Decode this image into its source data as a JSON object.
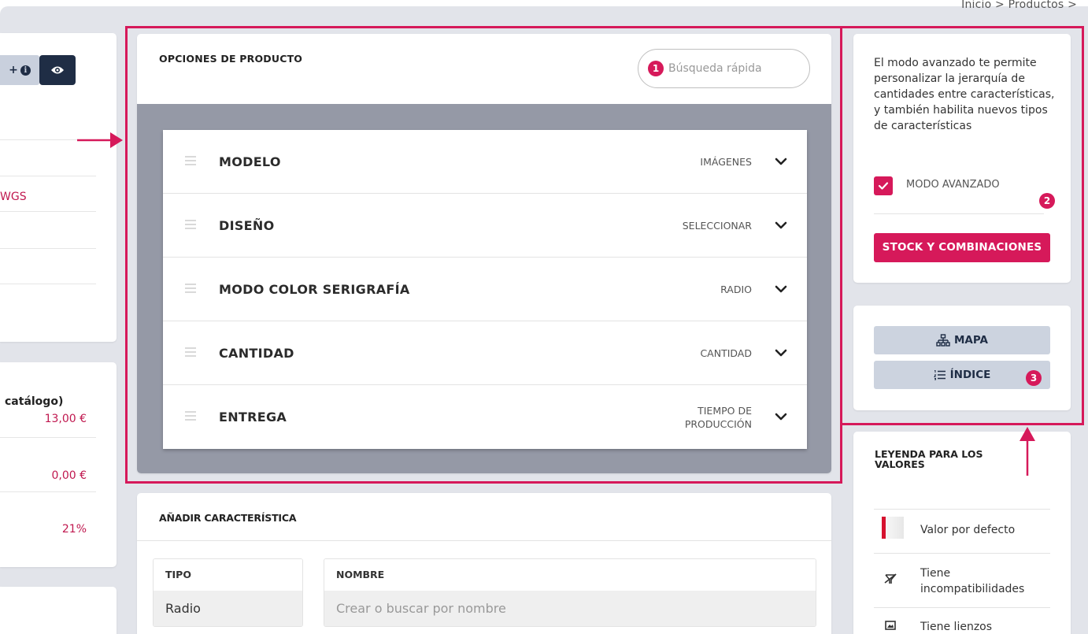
{
  "breadcrumb": "Inicio  >  Productos  >",
  "left_panel": {
    "button_plus": "+",
    "partial_link": "WGS",
    "catalog_title": "catálogo)",
    "prices": [
      "13,00 €",
      "0,00 €",
      "21%"
    ]
  },
  "product_options": {
    "title": "OPCIONES DE PRODUCTO",
    "search_placeholder": "Búsqueda rápida",
    "options": [
      {
        "name": "MODELO",
        "type": "IMÁGENES"
      },
      {
        "name": "DISEÑO",
        "type": "SELECCIONAR"
      },
      {
        "name": "MODO COLOR SERIGRAFÍA",
        "type": "RADIO"
      },
      {
        "name": "CANTIDAD",
        "type": "CANTIDAD"
      },
      {
        "name": "ENTREGA",
        "type_line1": "TIEMPO DE",
        "type_line2": "PRODUCCIÓN"
      }
    ]
  },
  "add_feature": {
    "title": "AÑADIR CARACTERÍSTICA",
    "type_label": "TIPO",
    "type_value": "Radio",
    "name_label": "NOMBRE",
    "name_placeholder": "Crear o buscar por nombre"
  },
  "advanced": {
    "description": "El modo avanzado te permite personalizar la jerarquía de cantidades entre características, y también habilita nuevos tipos de características",
    "checkbox_label": "MODO AVANZADO",
    "checked": true,
    "stock_button": "STOCK Y COMBINACIONES"
  },
  "navigation": {
    "map_button": "MAPA",
    "index_button": "ÍNDICE"
  },
  "legend": {
    "title": "LEYENDA PARA LOS VALORES",
    "items": [
      {
        "label": "Valor por defecto"
      },
      {
        "label_line1": "Tiene",
        "label_line2": "incompatibilidades"
      },
      {
        "label": "Tiene lienzos"
      }
    ]
  },
  "annotations": {
    "badges": [
      "1",
      "2",
      "3"
    ],
    "accent_color": "#d6195a"
  }
}
